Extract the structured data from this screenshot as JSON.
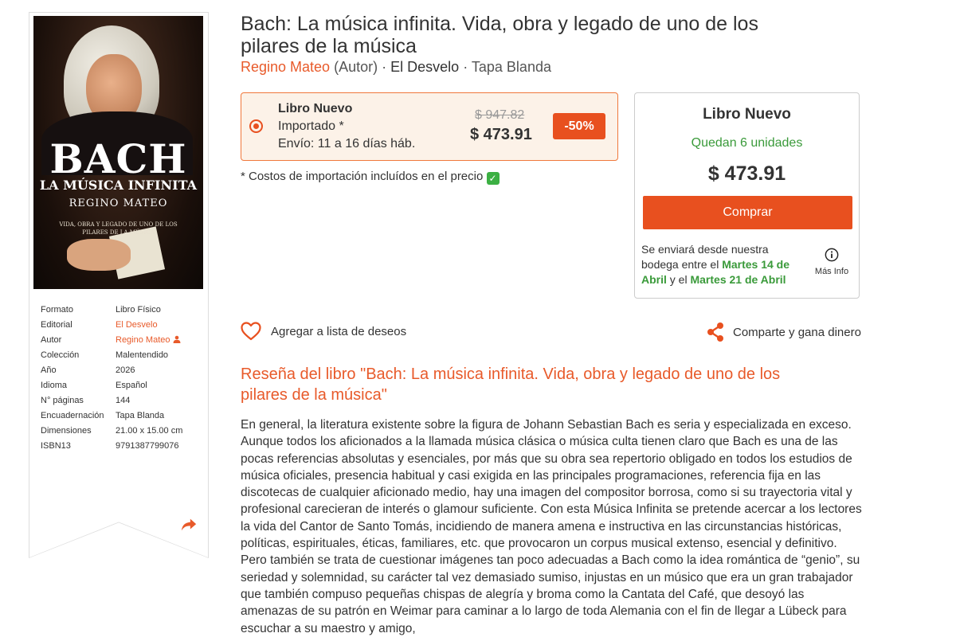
{
  "book": {
    "title": "Bach: La música infinita. Vida, obra y legado de uno de los pilares de la música",
    "author": "Regino Mateo",
    "author_role": "(Autor)",
    "separator": "·",
    "publisher": "El Desvelo",
    "binding": "Tapa Blanda"
  },
  "cover": {
    "title": "BACH",
    "subtitle": "LA MÚSICA INFINITA",
    "author": "REGINO MATEO",
    "tagline": "VIDA, OBRA Y LEGADO DE UNO DE LOS PILARES DE LA MÚSICA"
  },
  "specs": [
    {
      "label": "Formato",
      "value": "Libro Físico"
    },
    {
      "label": "Editorial",
      "value": "El Desvelo"
    },
    {
      "label": "Autor",
      "value": "Regino Mateo"
    },
    {
      "label": "Colección",
      "value": "Malentendido"
    },
    {
      "label": "Año",
      "value": "2026"
    },
    {
      "label": "Idioma",
      "value": "Español"
    },
    {
      "label": "N° páginas",
      "value": "144"
    },
    {
      "label": "Encuadernación",
      "value": "Tapa Blanda"
    },
    {
      "label": "Dimensiones",
      "value": "21.00 x 15.00 cm"
    },
    {
      "label": "ISBN13",
      "value": "9791387799076"
    }
  ],
  "offer": {
    "line1": "Libro Nuevo",
    "line2": "Importado *",
    "line3": "Envío: 11 a 16 días háb.",
    "old_price": "$ 947.82",
    "price": "$ 473.91",
    "discount": "-50%",
    "selected": true
  },
  "import_note": "* Costos de importación incluídos en el precio",
  "buybox": {
    "heading": "Libro Nuevo",
    "stock": "Quedan 6 unidades",
    "price": "$ 473.91",
    "buy_label": "Comprar",
    "ship_text_1": "Se enviará desde nuestra bodega entre el",
    "ship_date_1": "Martes 14 de Abril",
    "ship_text_2": "y el",
    "ship_date_2": "Martes 21 de Abril",
    "more_info": "Más Info"
  },
  "actions": {
    "wishlist": "Agregar a lista de deseos",
    "share": "Comparte y gana dinero"
  },
  "review": {
    "title": "Reseña del libro \"Bach: La música infinita. Vida, obra y legado de uno de los pilares de la música\"",
    "body": "En general, la literatura existente sobre la figura de Johann Sebastian Bach es seria y especializada en exceso. Aunque todos los aficionados a la llamada música clásica o música culta tienen claro que Bach es una de las pocas referencias absolutas y esenciales, por más que su obra sea repertorio obligado en todos los estudios de música oficiales, presencia habitual y casi exigida en las principales programaciones, referencia fija en las discotecas de cualquier aficionado medio, hay una imagen del compositor borrosa, como si su trayectoria vital y profesional carecieran de interés o glamour suficiente. Con esta Música Infinita se pretende acercar a los lectores la vida del Cantor de Santo Tomás, incidiendo de manera amena e instructiva en las circunstancias históricas, políticas, espirituales, éticas, familiares, etc. que provocaron un corpus musical extenso, esencial y definitivo. Pero también se trata de cuestionar imágenes tan poco adecuadas a Bach como la idea romántica de “genio”, su seriedad y solemnidad, su carácter tal vez demasiado sumiso, injustas en un músico que era un gran trabajador que también compuso pequeñas chispas de alegría y broma como la Cantata del Café, que desoyó las amenazas de su patrón en Weimar para caminar a lo largo de toda Alemania con el fin de llegar a Lübeck para escuchar a su maestro y amigo,"
  },
  "colors": {
    "accent": "#e85a2a",
    "green": "#3a9a3a",
    "offer_bg": "#fcf2e8"
  }
}
